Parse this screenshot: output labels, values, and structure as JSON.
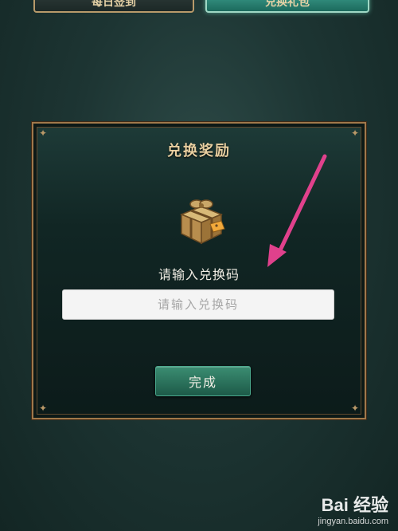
{
  "top_tabs": {
    "left_label": "每日签到",
    "right_label": "兑换礼包"
  },
  "dialog": {
    "title": "兑换奖励",
    "icon": "gift-box-icon",
    "prompt": "请输入兑换码",
    "input": {
      "value": "",
      "placeholder": "请输入兑换码"
    },
    "confirm_label": "完成"
  },
  "annotation": {
    "arrow_color": "#e0418c",
    "icon": "arrow-annotation-icon"
  },
  "watermark": {
    "logo": "Bai 经验",
    "url": "jingyan.baidu.com"
  },
  "colors": {
    "accent_gold": "#e8cfa0",
    "button_green": "#2f7a62",
    "frame_border": "#a0784a"
  }
}
